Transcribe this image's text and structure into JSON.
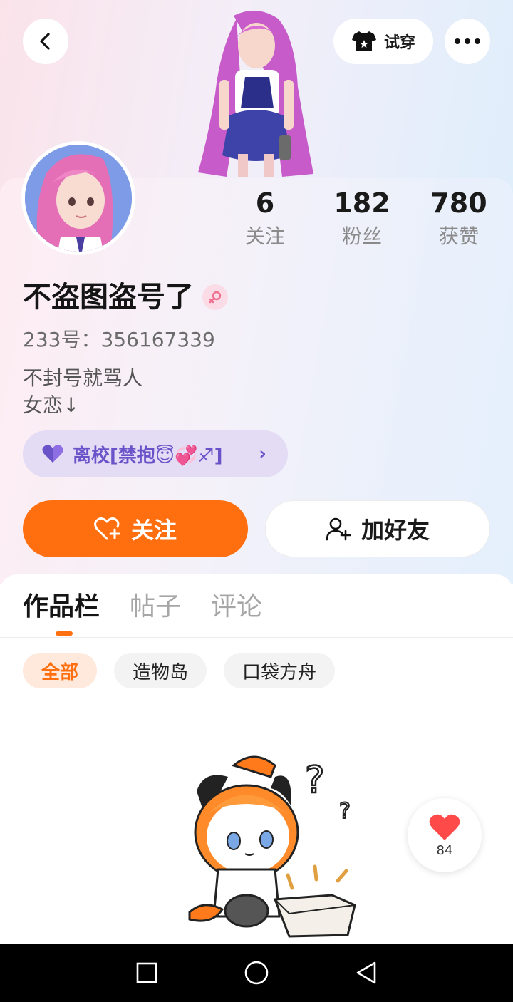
{
  "header": {
    "back_icon": "chevron-left-icon",
    "tryon_label": "试穿",
    "tryon_icon": "tshirt-icon",
    "more_icon": "more-dots-icon"
  },
  "profile": {
    "stats": [
      {
        "value": "6",
        "label": "关注"
      },
      {
        "value": "182",
        "label": "粉丝"
      },
      {
        "value": "780",
        "label": "获赞"
      }
    ],
    "nickname": "不盗图盗号了",
    "gender_icon": "female-icon",
    "uid": "233号：356167339",
    "bio_line1": "不封号就骂人",
    "bio_line2": "女恋↓",
    "title_badge": "离校[禁抱😇💞♐]",
    "title_icon": "heart-icon"
  },
  "actions": {
    "follow_label": "关注",
    "follow_icon": "heart-plus-icon",
    "add_friend_label": "加好友",
    "add_friend_icon": "user-plus-icon"
  },
  "tabs": [
    {
      "label": "作品栏",
      "active": true
    },
    {
      "label": "帖子",
      "active": false
    },
    {
      "label": "评论",
      "active": false
    }
  ],
  "filter_chips": [
    {
      "label": "全部",
      "active": true
    },
    {
      "label": "造物岛",
      "active": false
    },
    {
      "label": "口袋方舟",
      "active": false
    }
  ],
  "like_fab": {
    "count": "84",
    "icon": "heart-icon"
  },
  "colors": {
    "accent": "#ff6f0f",
    "title_badge_bg": "#e4dcf5",
    "title_badge_text": "#6a52c9"
  },
  "navbar": {
    "icons": [
      "square-icon",
      "circle-icon",
      "triangle-back-icon"
    ]
  }
}
